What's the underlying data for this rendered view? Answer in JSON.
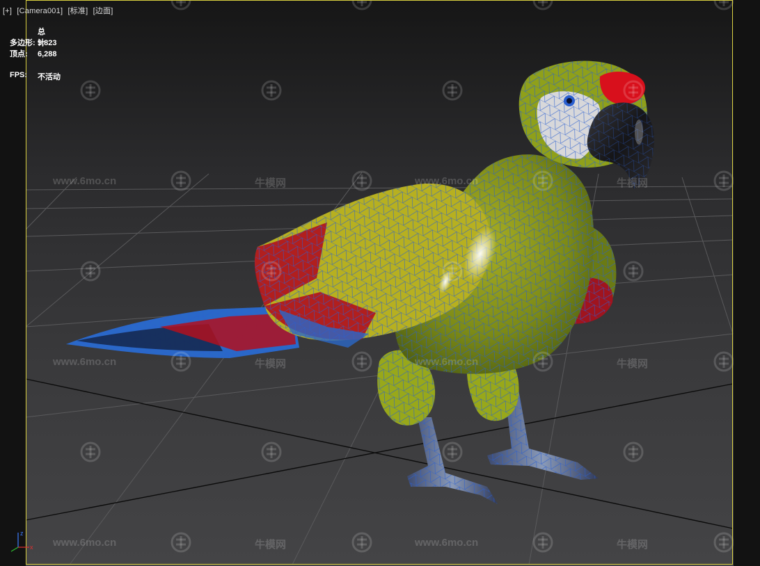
{
  "viewport": {
    "label_items": [
      "[+]",
      "[Camera001]",
      "[标准]",
      "[边面]"
    ]
  },
  "stats": {
    "header": "总计",
    "rows": [
      {
        "key": "多边形:",
        "value": "5,823"
      },
      {
        "key": "顶点:",
        "value": "6,288"
      }
    ],
    "fps_key": "FPS:",
    "fps_value": "不活动"
  },
  "watermarks": {
    "site": "www.6mo.cn",
    "brand": "牛模网"
  },
  "gizmo": {
    "x_label": "x",
    "z_label": "z"
  },
  "colors": {
    "viewport_border": "#d9d040",
    "wire": "#2a5fd0",
    "body_green": "#8c9a18",
    "wing_yellow": "#b7b020",
    "feather_red": "#b0101e",
    "feather_blue": "#2a68c8"
  }
}
